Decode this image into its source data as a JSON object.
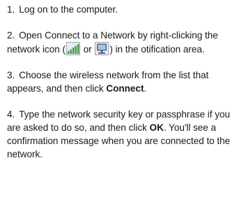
{
  "steps": [
    {
      "number": "1.",
      "text": "Log on to the computer."
    },
    {
      "number": "2.",
      "text_before": "Open Connect to a Network by right-clicking the network icon (",
      "icon1": "wireless-signal-bars-icon",
      "text_or": " or ",
      "icon2": "wired-network-computer-icon",
      "text_after": ") in the otification area."
    },
    {
      "number": "3.",
      "text_before": "Choose the wireless network from the list that appears, and then click ",
      "bold": "Connect",
      "text_after": "."
    },
    {
      "number": "4.",
      "text_before": "Type the network security key or passphrase if you are asked to do so, and then click ",
      "bold": "OK",
      "text_after": ". You'll see a confirmation message when you are connected to the network."
    }
  ],
  "colors": {
    "text": "#1a1a1a",
    "icon_green": "#3c9a3c",
    "icon_gray": "#9aa3ad"
  }
}
